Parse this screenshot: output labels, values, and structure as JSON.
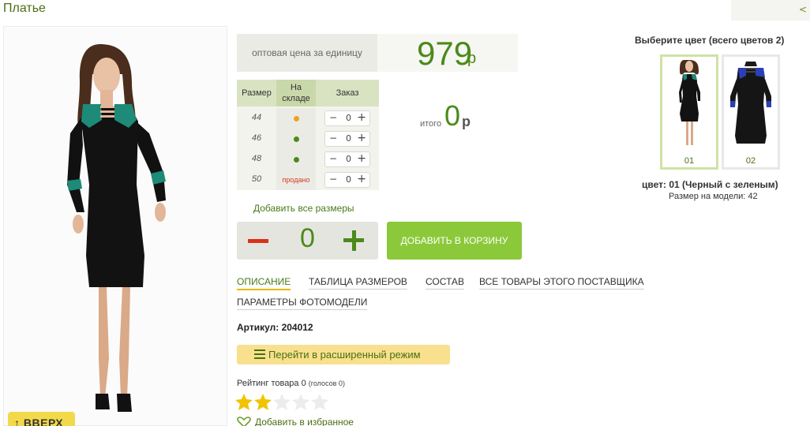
{
  "product": {
    "title": "Платье",
    "top_tab_glyph": "<"
  },
  "gallery": {
    "main_photo": "model-photo-dress-black-green",
    "up_button_label": "↑ ВВЕРХ"
  },
  "price": {
    "label": "оптовая цена за единицу",
    "value": "979",
    "currency": "р"
  },
  "size_table": {
    "headers": {
      "size": "Размер",
      "stock": "На складе",
      "order": "Заказ"
    },
    "rows": [
      {
        "size": "44",
        "stock": "low",
        "stock_color": "#f0a020",
        "qty": "0"
      },
      {
        "size": "46",
        "stock": "available",
        "stock_color": "#4a8a1a",
        "qty": "0"
      },
      {
        "size": "48",
        "stock": "available",
        "stock_color": "#4a8a1a",
        "qty": "0"
      },
      {
        "size": "50",
        "stock": "sold",
        "stock_label": "продано",
        "qty": "0"
      }
    ],
    "minus_glyph": "−",
    "plus_glyph": "+"
  },
  "total": {
    "label": "итого",
    "value": "0",
    "currency": "р"
  },
  "add_all_sizes_label": "Добавить все размеры",
  "cart": {
    "quantity": "0",
    "add_button_label": "ДОБАВИТЬ В КОРЗИНУ"
  },
  "tabs": [
    {
      "label": "ОПИСАНИЕ",
      "active": true
    },
    {
      "label": "ТАБЛИЦА РАЗМЕРОВ"
    },
    {
      "label": "СОСТАВ"
    },
    {
      "label": "ВСЕ ТОВАРЫ ЭТОГО ПОСТАВЩИКА"
    },
    {
      "label": "ПАРАМЕТРЫ ФОТОМОДЕЛИ"
    }
  ],
  "article": "Артикул: 204012",
  "extended_mode_label": "Перейти в расширенный режим",
  "rating": {
    "text": "Рейтинг товара 0",
    "votes": "(голосов 0)",
    "stars_filled": 2,
    "stars_total": 5
  },
  "favorites_label": "Добавить в избранное",
  "colors": {
    "title": "Выберите цвет (всего цветов 2)",
    "options": [
      {
        "code": "01",
        "accent": "#1f8a7a",
        "selected": true
      },
      {
        "code": "02",
        "accent": "#2a3fb8"
      }
    ],
    "selected_name": "цвет: 01 (Черный с зеленым)",
    "model_size": "Размер на модели: 42"
  },
  "colors_palette": {
    "brand_green": "#4a8a1a",
    "button_green": "#8bc93a",
    "minus_red": "#d9321a",
    "highlight_yellow": "#f8e08e"
  }
}
